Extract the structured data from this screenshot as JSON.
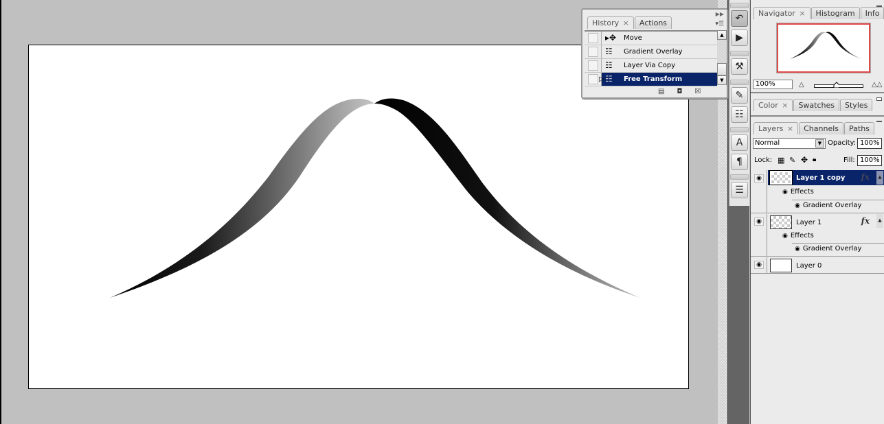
{
  "app": "Photoshop",
  "history_panel": {
    "tabs": [
      {
        "label": "History",
        "close": "×",
        "active": true
      },
      {
        "label": "Actions",
        "active": false
      }
    ],
    "items": [
      {
        "label": "Move",
        "icon": "move-tool-icon"
      },
      {
        "label": "Gradient Overlay",
        "icon": "history-state-icon"
      },
      {
        "label": "Layer Via Copy",
        "icon": "history-state-icon"
      },
      {
        "label": "Free Transform",
        "icon": "history-state-icon",
        "selected": true
      }
    ],
    "footer_icons": [
      "new-document-from-state-icon",
      "snapshot-icon",
      "trash-icon"
    ]
  },
  "dock_icons": [
    "history-icon",
    "actions-icon",
    "tools-icon",
    "brushes-icon",
    "clone-source-icon",
    "character-icon",
    "paragraph-icon",
    "layer-comps-icon"
  ],
  "navigator_panel": {
    "tabs": [
      {
        "label": "Navigator",
        "close": "×",
        "active": true
      },
      {
        "label": "Histogram",
        "active": false
      },
      {
        "label": "Info",
        "active": false
      }
    ],
    "zoom_value": "100%",
    "zoom_slider_fraction": 0.45,
    "view_box_color": "#e04a4a"
  },
  "color_panel": {
    "tabs": [
      {
        "label": "Color",
        "close": "×",
        "active": true
      },
      {
        "label": "Swatches",
        "active": false
      },
      {
        "label": "Styles",
        "active": false
      }
    ]
  },
  "layers_panel": {
    "tabs": [
      {
        "label": "Layers",
        "close": "×",
        "active": true
      },
      {
        "label": "Channels",
        "active": false
      },
      {
        "label": "Paths",
        "active": false
      }
    ],
    "blend_mode": "Normal",
    "opacity_label": "Opacity:",
    "opacity": "100%",
    "lock_label": "Lock:",
    "fill_label": "Fill:",
    "fill": "100%",
    "layers": [
      {
        "name": "Layer 1 copy",
        "selected": true,
        "fx": "fx",
        "effects_label": "Effects",
        "effects": [
          "Gradient Overlay"
        ]
      },
      {
        "name": "Layer 1",
        "selected": false,
        "fx": "fx",
        "effects_label": "Effects",
        "effects": [
          "Gradient Overlay"
        ]
      },
      {
        "name": "Layer 0",
        "selected": false
      }
    ],
    "selection_color": "#0a246a"
  },
  "canvas": {
    "background": "#ffffff",
    "shapes": [
      {
        "name": "left-curve-stroke",
        "gradient_from": "#000000",
        "gradient_to": "#c0c0c0"
      },
      {
        "name": "right-curve-stroke",
        "gradient_from": "#000000",
        "gradient_to": "#b8b8b8"
      }
    ]
  }
}
